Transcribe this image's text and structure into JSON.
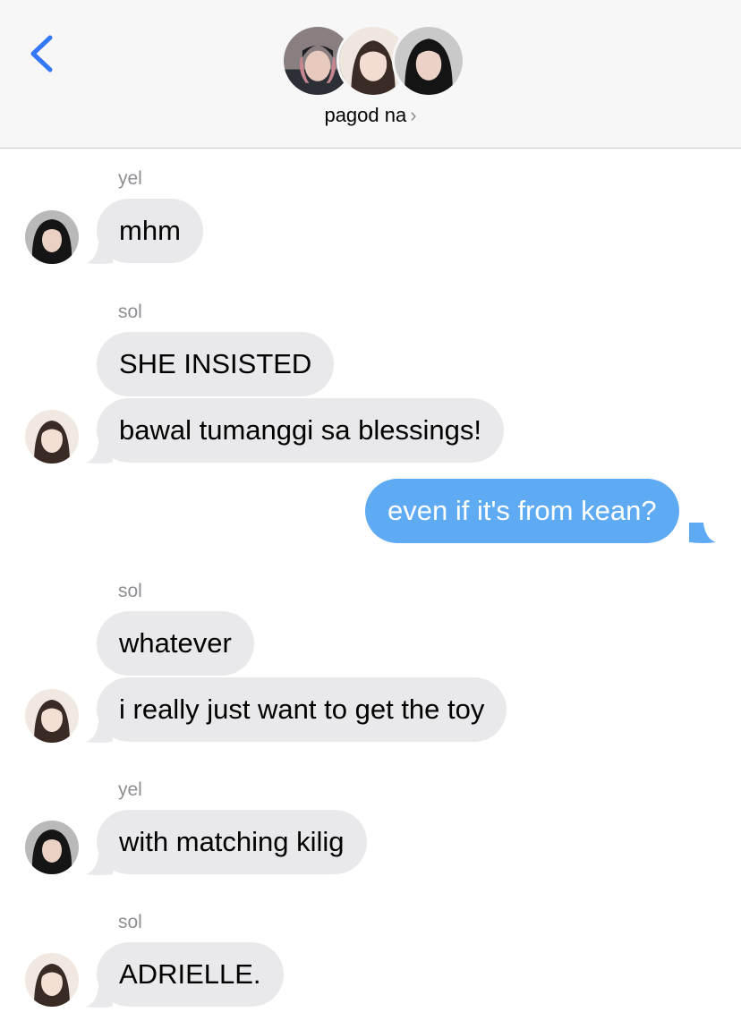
{
  "header": {
    "group_name": "pagod na",
    "chevron": "›",
    "back_icon": "chevron-left-icon",
    "accent": "#3478f6"
  },
  "messages": [
    {
      "sender": "yel",
      "bubbles": [
        "mhm"
      ]
    },
    {
      "sender": "sol",
      "bubbles": [
        "SHE INSISTED",
        "bawal tumanggi sa blessings!"
      ]
    },
    {
      "sender": "me",
      "bubbles": [
        "even if it's from kean?"
      ]
    },
    {
      "sender": "sol",
      "bubbles": [
        "whatever",
        "i really just want to get the toy"
      ]
    },
    {
      "sender": "yel",
      "bubbles": [
        "with matching kilig"
      ]
    },
    {
      "sender": "sol",
      "bubbles": [
        "ADRIELLE."
      ]
    }
  ],
  "colors": {
    "incoming_bubble": "#e9e9eb",
    "outgoing_bubble": "#5eaaf3",
    "sender_label": "#8e8e93"
  }
}
